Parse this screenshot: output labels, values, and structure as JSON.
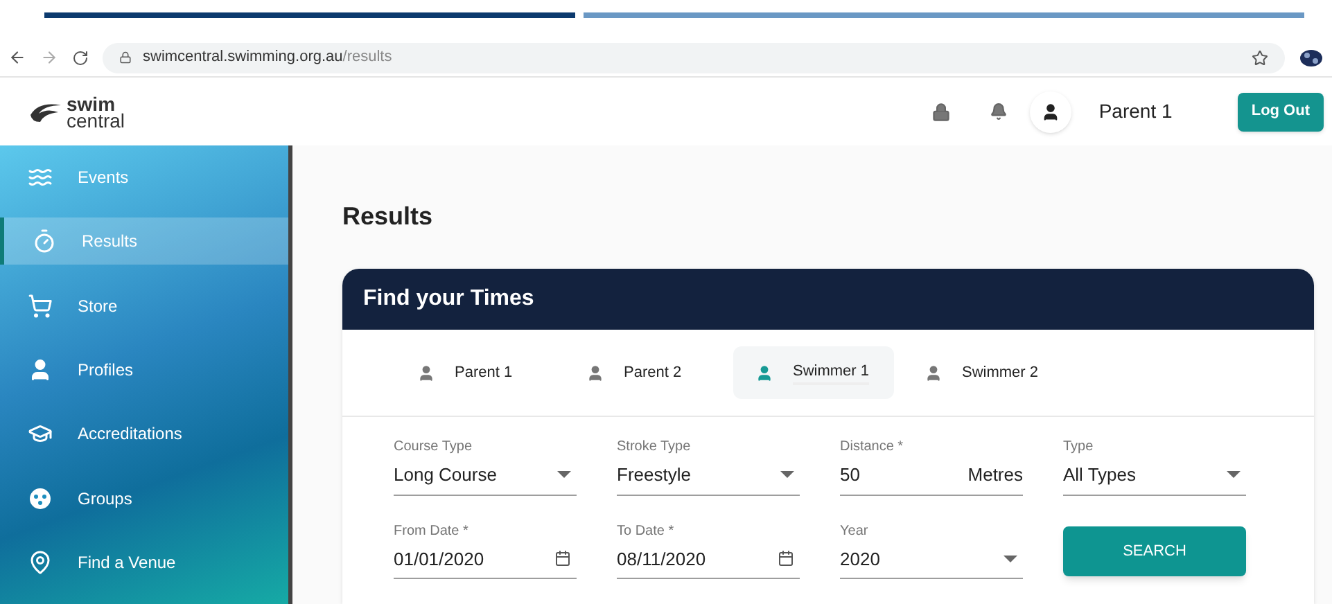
{
  "browser": {
    "url_host": "swimcentral.swimming.org.au",
    "url_path": "/results"
  },
  "header": {
    "logo_top": "swim",
    "logo_bottom": "central",
    "user_name": "Parent 1",
    "logout": "Log Out"
  },
  "sidebar": {
    "items": [
      {
        "label": "Events",
        "selected": false
      },
      {
        "label": "Results",
        "selected": true
      },
      {
        "label": "Store",
        "selected": false
      },
      {
        "label": "Profiles",
        "selected": false
      },
      {
        "label": "Accreditations",
        "selected": false
      },
      {
        "label": "Groups",
        "selected": false
      },
      {
        "label": "Find a Venue",
        "selected": false
      }
    ]
  },
  "page_title": "Results",
  "card": {
    "title": "Find your Times",
    "tabs": [
      {
        "label": "Parent 1",
        "selected": false
      },
      {
        "label": "Parent 2",
        "selected": false
      },
      {
        "label": "Swimmer 1",
        "selected": true
      },
      {
        "label": "Swimmer 2",
        "selected": false
      }
    ],
    "fields": [
      {
        "kind": "select",
        "label": "Course Type",
        "value": "Long Course"
      },
      {
        "kind": "select",
        "label": "Stroke Type",
        "value": "Freestyle"
      },
      {
        "kind": "text",
        "label": "Distance *",
        "value": "50",
        "suffix": "Metres"
      },
      {
        "kind": "select",
        "label": "Type",
        "value": "All Types"
      },
      {
        "kind": "date",
        "label": "From Date *",
        "value": "01/01/2020"
      },
      {
        "kind": "date",
        "label": "To Date *",
        "value": "08/11/2020"
      },
      {
        "kind": "select",
        "label": "Year",
        "value": "2020"
      }
    ],
    "search_button": "SEARCH"
  }
}
